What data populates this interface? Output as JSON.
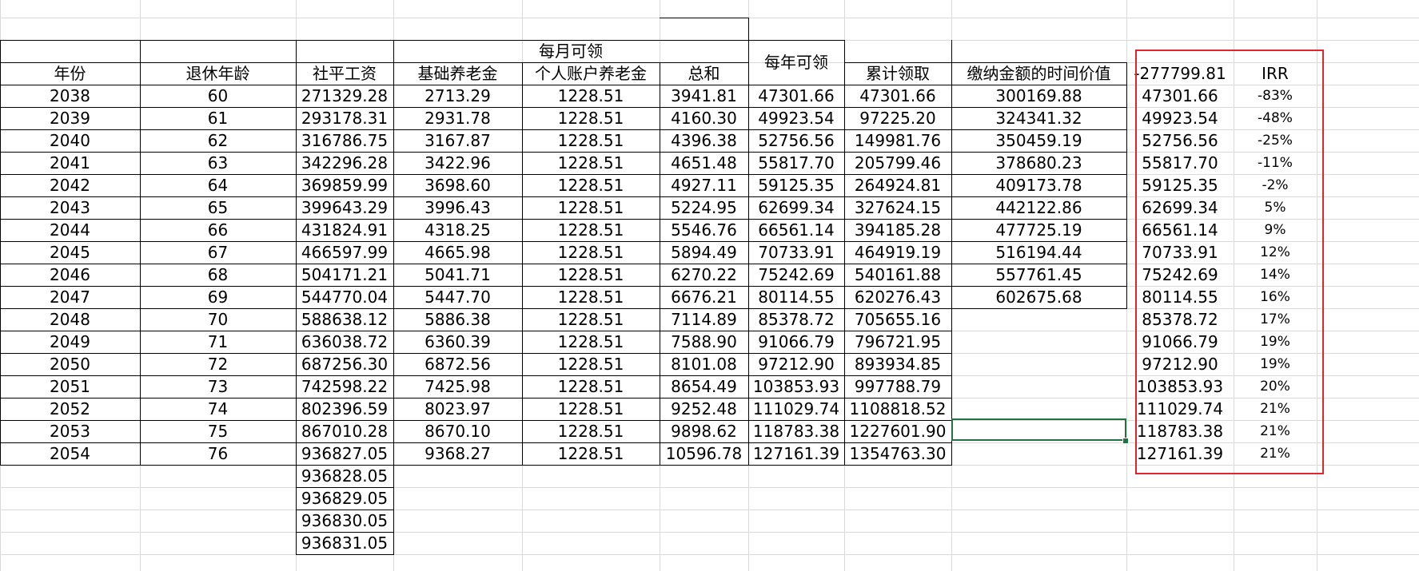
{
  "header": {
    "monthly_group": "每月可领",
    "annual": "每年可领",
    "year": "年份",
    "retire_age": "退休年龄",
    "avg_wage": "社平工资",
    "basic_pension": "基础养老金",
    "personal_pension": "个人账户养老金",
    "total": "总和",
    "cumulative": "累计领取",
    "time_value": "缴纳金额的时间价值",
    "cashflow_start": "-277799.81",
    "irr": "IRR"
  },
  "rows": [
    [
      "2038",
      "60",
      "271329.28",
      "2713.29",
      "1228.51",
      "3941.81",
      "47301.66",
      "47301.66",
      "300169.88",
      "47301.66",
      "-83%"
    ],
    [
      "2039",
      "61",
      "293178.31",
      "2931.78",
      "1228.51",
      "4160.30",
      "49923.54",
      "97225.20",
      "324341.32",
      "49923.54",
      "-48%"
    ],
    [
      "2040",
      "62",
      "316786.75",
      "3167.87",
      "1228.51",
      "4396.38",
      "52756.56",
      "149981.76",
      "350459.19",
      "52756.56",
      "-25%"
    ],
    [
      "2041",
      "63",
      "342296.28",
      "3422.96",
      "1228.51",
      "4651.48",
      "55817.70",
      "205799.46",
      "378680.23",
      "55817.70",
      "-11%"
    ],
    [
      "2042",
      "64",
      "369859.99",
      "3698.60",
      "1228.51",
      "4927.11",
      "59125.35",
      "264924.81",
      "409173.78",
      "59125.35",
      "-2%"
    ],
    [
      "2043",
      "65",
      "399643.29",
      "3996.43",
      "1228.51",
      "5224.95",
      "62699.34",
      "327624.15",
      "442122.86",
      "62699.34",
      "5%"
    ],
    [
      "2044",
      "66",
      "431824.91",
      "4318.25",
      "1228.51",
      "5546.76",
      "66561.14",
      "394185.28",
      "477725.19",
      "66561.14",
      "9%"
    ],
    [
      "2045",
      "67",
      "466597.99",
      "4665.98",
      "1228.51",
      "5894.49",
      "70733.91",
      "464919.19",
      "516194.44",
      "70733.91",
      "12%"
    ],
    [
      "2046",
      "68",
      "504171.21",
      "5041.71",
      "1228.51",
      "6270.22",
      "75242.69",
      "540161.88",
      "557761.45",
      "75242.69",
      "14%"
    ],
    [
      "2047",
      "69",
      "544770.04",
      "5447.70",
      "1228.51",
      "6676.21",
      "80114.55",
      "620276.43",
      "602675.68",
      "80114.55",
      "16%"
    ],
    [
      "2048",
      "70",
      "588638.12",
      "5886.38",
      "1228.51",
      "7114.89",
      "85378.72",
      "705655.16",
      "",
      "85378.72",
      "17%"
    ],
    [
      "2049",
      "71",
      "636038.72",
      "6360.39",
      "1228.51",
      "7588.90",
      "91066.79",
      "796721.95",
      "",
      "91066.79",
      "19%"
    ],
    [
      "2050",
      "72",
      "687256.30",
      "6872.56",
      "1228.51",
      "8101.08",
      "97212.90",
      "893934.85",
      "",
      "97212.90",
      "19%"
    ],
    [
      "2051",
      "73",
      "742598.22",
      "7425.98",
      "1228.51",
      "8654.49",
      "103853.93",
      "997788.79",
      "",
      "103853.93",
      "20%"
    ],
    [
      "2052",
      "74",
      "802396.59",
      "8023.97",
      "1228.51",
      "9252.48",
      "111029.74",
      "1108818.52",
      "",
      "111029.74",
      "21%"
    ],
    [
      "2053",
      "75",
      "867010.28",
      "8670.10",
      "1228.51",
      "9898.62",
      "118783.38",
      "1227601.90",
      "",
      "118783.38",
      "21%"
    ],
    [
      "2054",
      "76",
      "936827.05",
      "9368.27",
      "1228.51",
      "10596.78",
      "127161.39",
      "1354763.30",
      "",
      "127161.39",
      "21%"
    ]
  ],
  "extra_wages": [
    "936828.05",
    "936829.05",
    "936830.05",
    "936831.05"
  ],
  "colors": {
    "selection": "#217346",
    "highlight_box": "#e0262b",
    "gridline": "#dadada"
  }
}
